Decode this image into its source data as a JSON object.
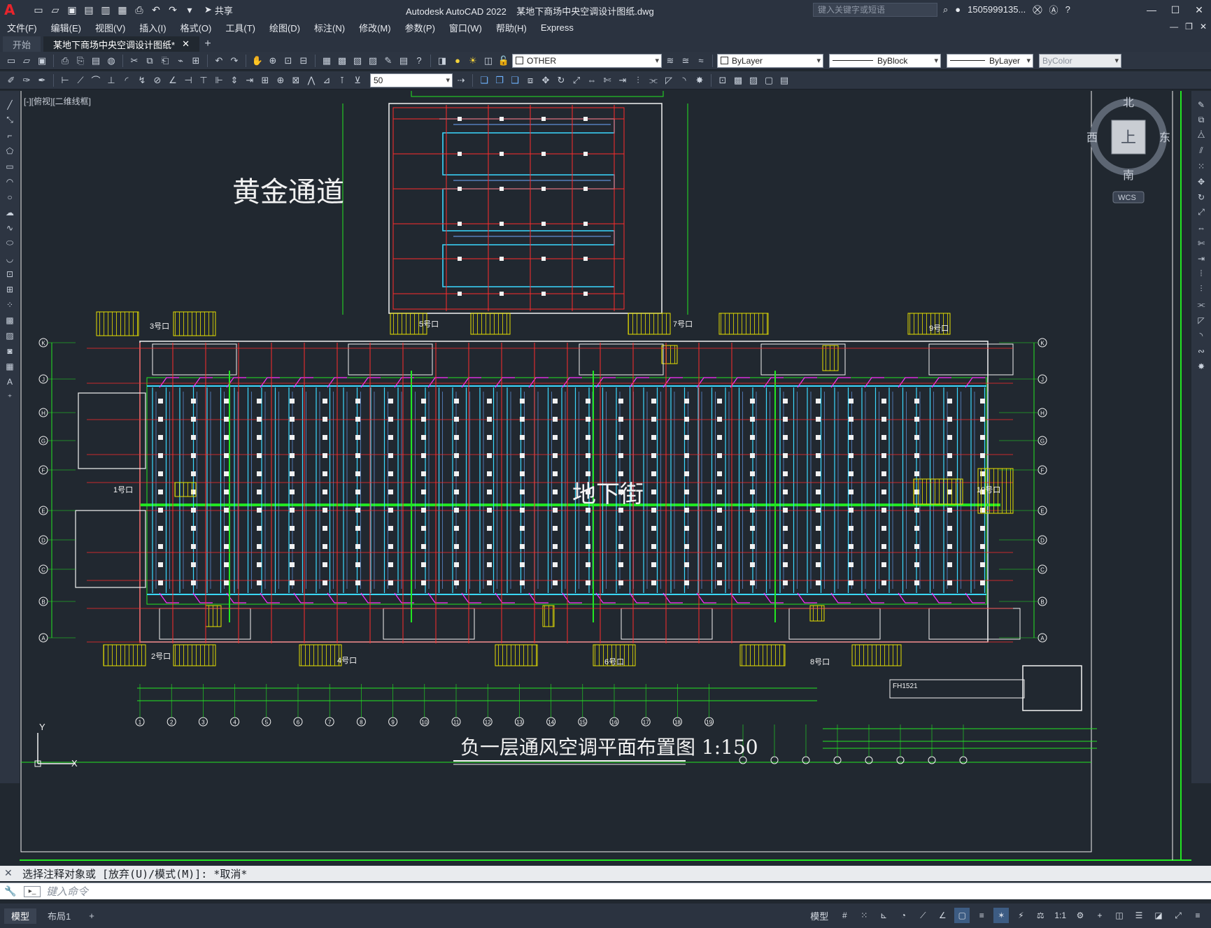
{
  "titlebar": {
    "app_name": "Autodesk AutoCAD 2022",
    "document": "某地下商场中央空调设计图纸.dwg",
    "share_label": "共享",
    "search_placeholder": "键入关键字或短语",
    "user": "1505999135..."
  },
  "menu": [
    "文件(F)",
    "编辑(E)",
    "视图(V)",
    "插入(I)",
    "格式(O)",
    "工具(T)",
    "绘图(D)",
    "标注(N)",
    "修改(M)",
    "参数(P)",
    "窗口(W)",
    "帮助(H)",
    "Express"
  ],
  "tabs": [
    {
      "label": "开始"
    },
    {
      "label": "某地下商场中央空调设计图纸*"
    }
  ],
  "properties": {
    "layer": "OTHER",
    "color": "ByLayer",
    "linetype": "ByBlock",
    "lineweight": "ByLayer",
    "plotstyle": "ByColor",
    "dim_scale": "50"
  },
  "canvas": {
    "viewport_label": "[-][俯视][二维线框]",
    "compass": {
      "north": "北",
      "south": "南",
      "east": "东",
      "west": "西",
      "face": "上",
      "ucs": "WCS"
    },
    "drawing_texts": {
      "golden_passage": "黄金通道",
      "underground_street": "地下街",
      "plan_title": "负一层通风空调平面布置图 1:150",
      "exit_3": "3号口",
      "exit_5": "5号口",
      "exit_7": "7号口",
      "exit_9": "9号口",
      "exit_1": "1号口",
      "exit_2": "2号口",
      "exit_4": "4号口",
      "exit_6": "6号口",
      "exit_8": "8号口",
      "exit_10": "10号口",
      "fh_tag": "FH1521"
    },
    "row_axes": [
      "K",
      "J",
      "H",
      "G",
      "F",
      "E",
      "D",
      "C",
      "B",
      "A"
    ],
    "column_axes": [
      "1",
      "2",
      "3",
      "4",
      "5",
      "6",
      "7",
      "8",
      "9",
      "10",
      "11",
      "12",
      "13",
      "14",
      "15",
      "16",
      "17",
      "18",
      "19"
    ],
    "ucs_x": "X",
    "ucs_y": "Y"
  },
  "command": {
    "history": "选择注释对象或 [放弃(U)/模式(M)]: *取消*",
    "placeholder": "键入命令"
  },
  "status": {
    "layouts": [
      "模型",
      "布局1"
    ],
    "model_button": "模型",
    "scale": "1:1"
  },
  "colors": {
    "wall_green": "#22e622",
    "red_axis": "#ff2b2b",
    "duct_cyan": "#3ad8ff",
    "duct_blue": "#6fa8ff",
    "magenta": "#ff30ff",
    "yellow_hatch": "#e6e000",
    "white": "#f2f2f2"
  }
}
